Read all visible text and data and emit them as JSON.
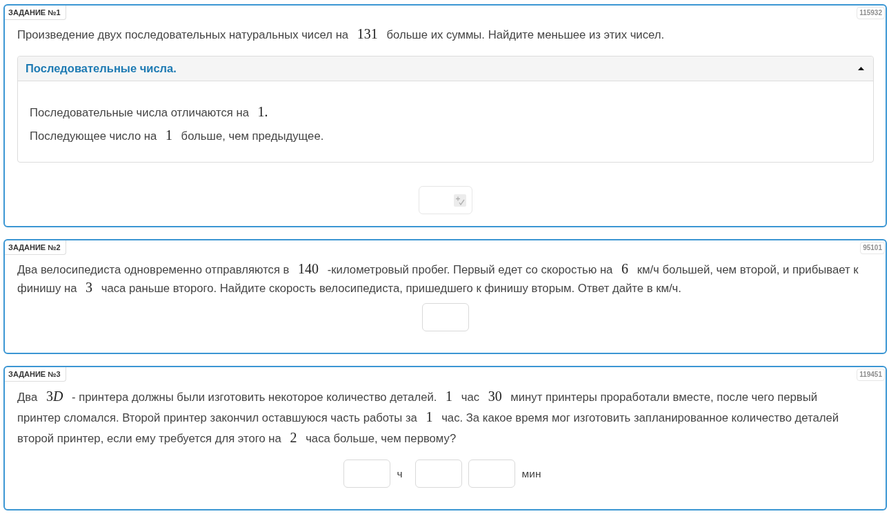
{
  "tasks": [
    {
      "label": "ЗАДАНИЕ №1",
      "number": "115932",
      "text": [
        {
          "kind": "text",
          "text": "Произведение двух последовательных натуральных чисел на"
        },
        {
          "kind": "math",
          "parts": [
            {
              "kind": "number",
              "text": "131"
            }
          ]
        },
        {
          "kind": "text",
          "text": "больше их суммы. Найдите меньшее из этих чисел."
        }
      ],
      "hint": {
        "title": "Последовательные числа.",
        "expanded": true,
        "lines": [
          [
            {
              "kind": "text",
              "text": "Последовательные числа отличаются на"
            },
            {
              "kind": "math",
              "parts": [
                {
                  "kind": "number",
                  "text": "1."
                }
              ]
            }
          ],
          [
            {
              "kind": "text",
              "text": "Последующее число на"
            },
            {
              "kind": "math",
              "parts": [
                {
                  "kind": "number",
                  "text": "1"
                }
              ]
            },
            {
              "kind": "text",
              "text": "больше, чем предыдущее."
            }
          ]
        ]
      },
      "answer": [
        {
          "kind": "formula_field"
        }
      ]
    },
    {
      "label": "ЗАДАНИЕ №2",
      "number": "95101",
      "text": [
        {
          "kind": "text",
          "text": "Два велосипедиста одновременно отправляются в"
        },
        {
          "kind": "math",
          "parts": [
            {
              "kind": "number",
              "text": "140"
            }
          ]
        },
        {
          "kind": "text",
          "text": "-километровый пробег. Первый едет со скоростью на"
        },
        {
          "kind": "math",
          "parts": [
            {
              "kind": "number",
              "text": "6"
            }
          ]
        },
        {
          "kind": "text",
          "text": "км/ч большей, чем второй, и прибывает к финишу на"
        },
        {
          "kind": "math",
          "parts": [
            {
              "kind": "number",
              "text": "3"
            }
          ]
        },
        {
          "kind": "text",
          "text": "часа раньше второго. Найдите скорость велосипедиста, пришедшего к финишу вторым. Ответ дайте в км/ч."
        }
      ],
      "answer": [
        {
          "kind": "field"
        }
      ]
    },
    {
      "label": "ЗАДАНИЕ №3",
      "number": "119451",
      "text": [
        {
          "kind": "text",
          "text": "Два"
        },
        {
          "kind": "math",
          "parts": [
            {
              "kind": "number",
              "text": "3"
            },
            {
              "kind": "variable",
              "text": "D"
            }
          ]
        },
        {
          "kind": "text",
          "text": "- принтера должны были изготовить некоторое количество деталей."
        },
        {
          "kind": "math",
          "parts": [
            {
              "kind": "number",
              "text": "1"
            }
          ]
        },
        {
          "kind": "text",
          "text": "час"
        },
        {
          "kind": "math",
          "parts": [
            {
              "kind": "number",
              "text": "30"
            }
          ]
        },
        {
          "kind": "text",
          "text": "минут принтеры проработали вместе, после чего первый принтер сломался. Второй принтер закончил оставшуюся часть работы за"
        },
        {
          "kind": "math",
          "parts": [
            {
              "kind": "number",
              "text": "1"
            }
          ]
        },
        {
          "kind": "text",
          "text": "час. За какое время мог изготовить запланированное количество деталей второй принтер, если ему требуется для этого на"
        },
        {
          "kind": "math",
          "parts": [
            {
              "kind": "number",
              "text": "2"
            }
          ]
        },
        {
          "kind": "text",
          "text": "часа больше, чем первому?"
        }
      ],
      "answer": [
        {
          "kind": "field"
        },
        {
          "kind": "unit",
          "text": "ч"
        },
        {
          "kind": "field"
        },
        {
          "kind": "field"
        },
        {
          "kind": "unit",
          "text": "мин"
        }
      ]
    }
  ]
}
